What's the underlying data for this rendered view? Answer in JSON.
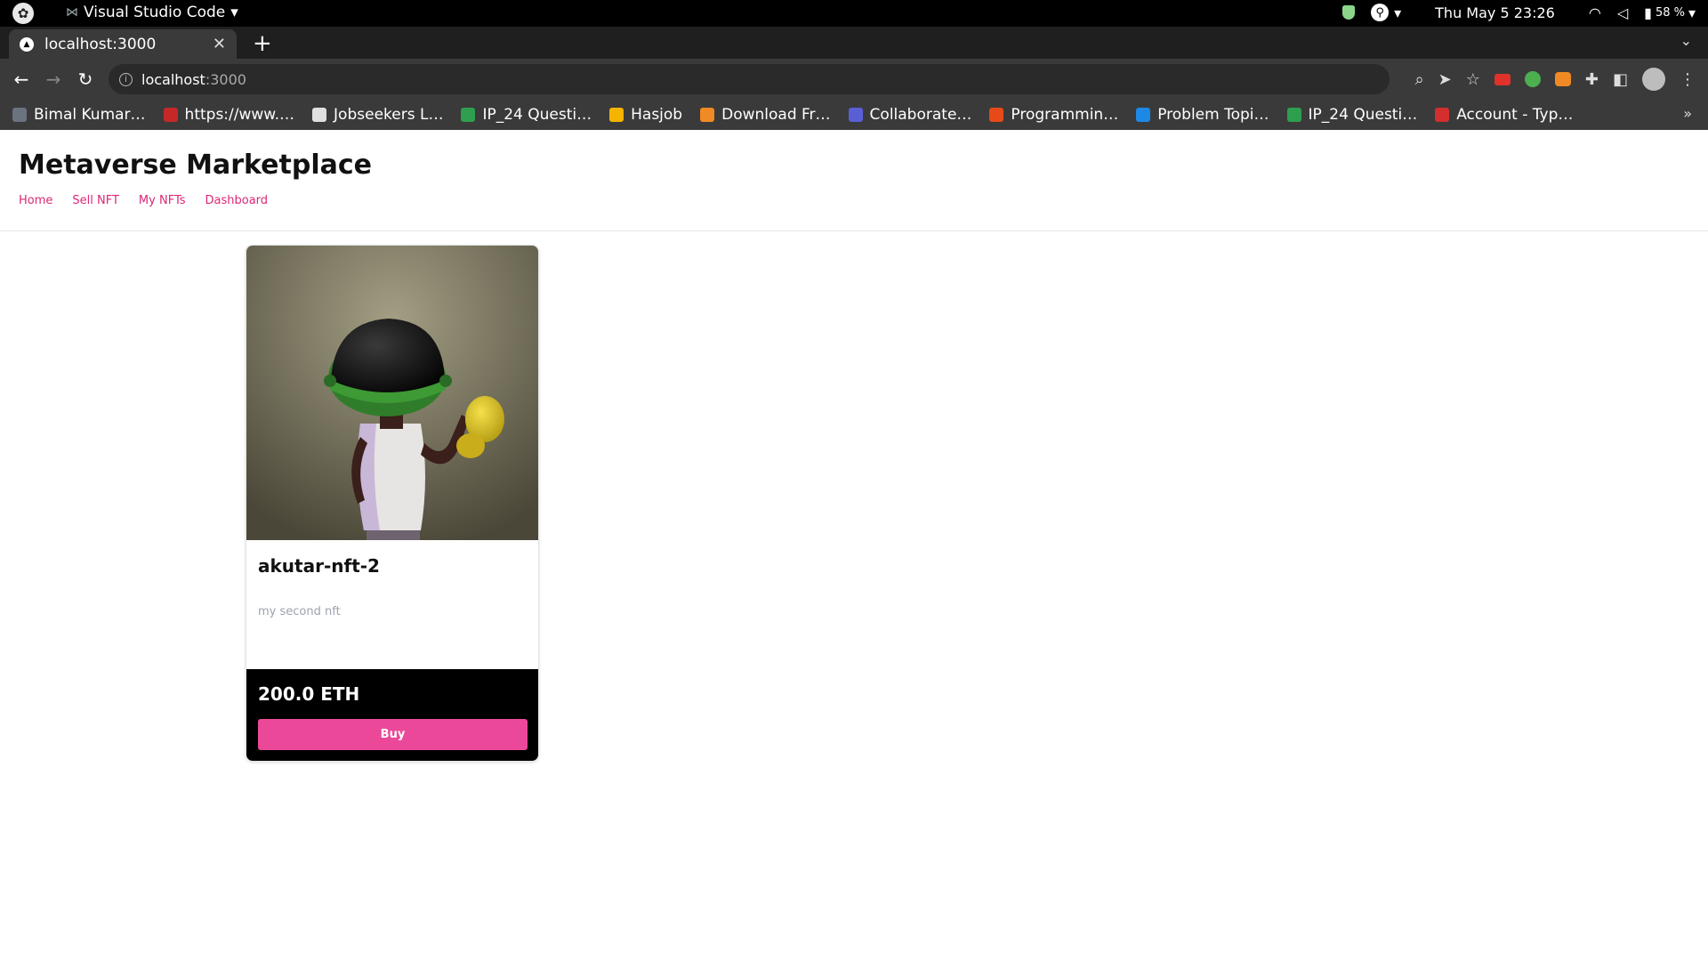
{
  "os": {
    "app_name": "Visual Studio Code",
    "clock": "Thu May 5  23:26",
    "battery": "58 %"
  },
  "browser": {
    "tab_title": "localhost:3000",
    "url_host": "localhost",
    "url_port": ":3000",
    "bookmarks": [
      {
        "label": "Bimal Kumar…",
        "color": "#6b7280"
      },
      {
        "label": "https://www.…",
        "color": "#c62828"
      },
      {
        "label": "Jobseekers L…",
        "color": "#e0e0e0"
      },
      {
        "label": "IP_24 Questi…",
        "color": "#2e9e4f"
      },
      {
        "label": "Hasjob",
        "color": "#f5b400"
      },
      {
        "label": "Download Fr…",
        "color": "#f08a24"
      },
      {
        "label": "Collaborate…",
        "color": "#5b5fd6"
      },
      {
        "label": "Programmin…",
        "color": "#e64a19"
      },
      {
        "label": "Problem Topi…",
        "color": "#1e88e5"
      },
      {
        "label": "IP_24 Questi…",
        "color": "#2e9e4f"
      },
      {
        "label": "Account - Typ…",
        "color": "#d32f2f"
      }
    ],
    "bookmarks_more": "»"
  },
  "site": {
    "title": "Metaverse Marketplace",
    "nav": [
      "Home",
      "Sell NFT",
      "My NFTs",
      "Dashboard"
    ],
    "accent_color": "#db2777"
  },
  "nft": {
    "name": "akutar-nft-2",
    "description": "my second nft",
    "price": "200.0 ETH",
    "buy_label": "Buy"
  }
}
